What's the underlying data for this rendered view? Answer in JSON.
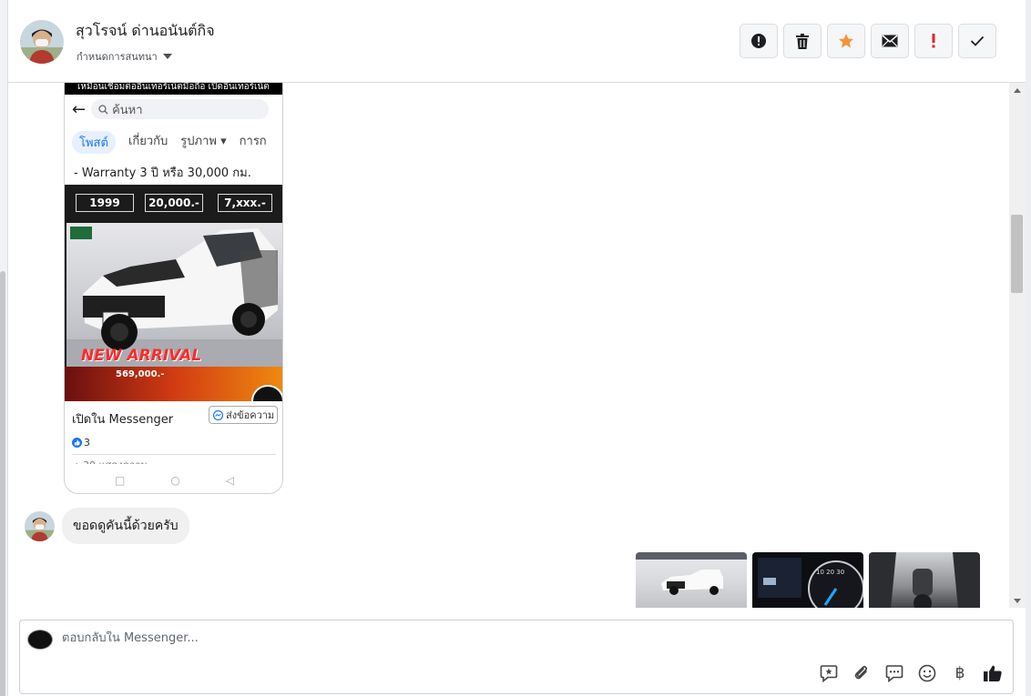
{
  "header": {
    "name": "สุวโรจน์ ด่านอนันต์กิจ",
    "subtitle": "กำหนดการสนทนา",
    "actions": [
      {
        "name": "report-action-button",
        "icon": "exclamation-circle-icon"
      },
      {
        "name": "delete-action-button",
        "icon": "trash-icon"
      },
      {
        "name": "star-action-button",
        "icon": "star-icon"
      },
      {
        "name": "mark-unread-action-button",
        "icon": "envelope-icon"
      },
      {
        "name": "important-action-button",
        "icon": "exclamation-icon"
      },
      {
        "name": "done-action-button",
        "icon": "checkmark-icon"
      }
    ]
  },
  "shared_screenshot": {
    "banner": "เหมือนเชื่อมต่ออินเทอร์เน็ตมือถือ เปิดอินเทอร์เน็ต",
    "search_placeholder": "ค้นหา",
    "tabs": [
      "โพสต์",
      "เกี่ยวกับ",
      "รูปภาพ",
      "การก"
    ],
    "post_text": "- Warranty 3 ปี หรือ 30,000 กม.",
    "ad": {
      "prices": [
        "1999",
        "20,000.-",
        "7,xxx.-"
      ],
      "headline": "NEW ARRIVAL",
      "price": "569,000.-"
    },
    "open_in_messenger": "เปิดใน Messenger",
    "send_message": "ส่งข้อความ",
    "likes": "3",
    "cut_text": "• 30 แสดงความ"
  },
  "messages": [
    {
      "direction": "incoming",
      "text": "ขอดดูคันนี้ด้วยครับ"
    }
  ],
  "outgoing_images": [
    {
      "name": "truck-photo-thumbnail",
      "icon": "image-icon"
    },
    {
      "name": "dashboard-photo-thumbnail",
      "icon": "image-icon"
    },
    {
      "name": "gearshift-photo-thumbnail",
      "icon": "image-icon"
    }
  ],
  "composer": {
    "placeholder": "ตอบกลับใน Messenger...",
    "tools": [
      "saved-reply-icon",
      "attachment-icon",
      "quick-replies-icon",
      "emoji-icon",
      "payment-icon",
      "thumbs-up-icon"
    ],
    "baht_symbol": "฿"
  },
  "colors": {
    "star": "#f7923b",
    "important": "#e0242b",
    "link": "#1877f2"
  }
}
